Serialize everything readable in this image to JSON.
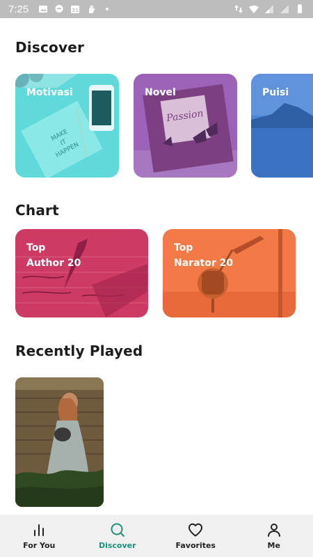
{
  "status_bar": {
    "time": "7:25",
    "left_icons": [
      "image-icon",
      "chat-icon",
      "calendar-icon",
      "hand-icon",
      "dot-icon"
    ],
    "right_icons": [
      "data-arrows-icon",
      "wifi-icon",
      "signal-icon",
      "signal-icon",
      "battery-icon"
    ]
  },
  "discover": {
    "title": "Discover",
    "cards": [
      {
        "label": "Motivasi",
        "tint": "#4fd6d8"
      },
      {
        "label": "Novel",
        "tint": "#9a5fb6"
      },
      {
        "label": "Puisi",
        "tint": "#3d7fd3"
      }
    ]
  },
  "chart": {
    "title": "Chart",
    "cards": [
      {
        "label_line1": "Top",
        "label_line2": "Author 20",
        "tint": "#c8305f"
      },
      {
        "label_line1": "Top",
        "label_line2": "Narator 20",
        "tint": "#f07a45"
      }
    ]
  },
  "recently_played": {
    "title": "Recently Played"
  },
  "bottom_nav": {
    "active_color": "#1f8f7e",
    "items": [
      {
        "label": "For You",
        "icon": "bar-chart-icon"
      },
      {
        "label": "Discover",
        "icon": "search-icon"
      },
      {
        "label": "Favorites",
        "icon": "heart-icon"
      },
      {
        "label": "Me",
        "icon": "person-icon"
      }
    ]
  }
}
